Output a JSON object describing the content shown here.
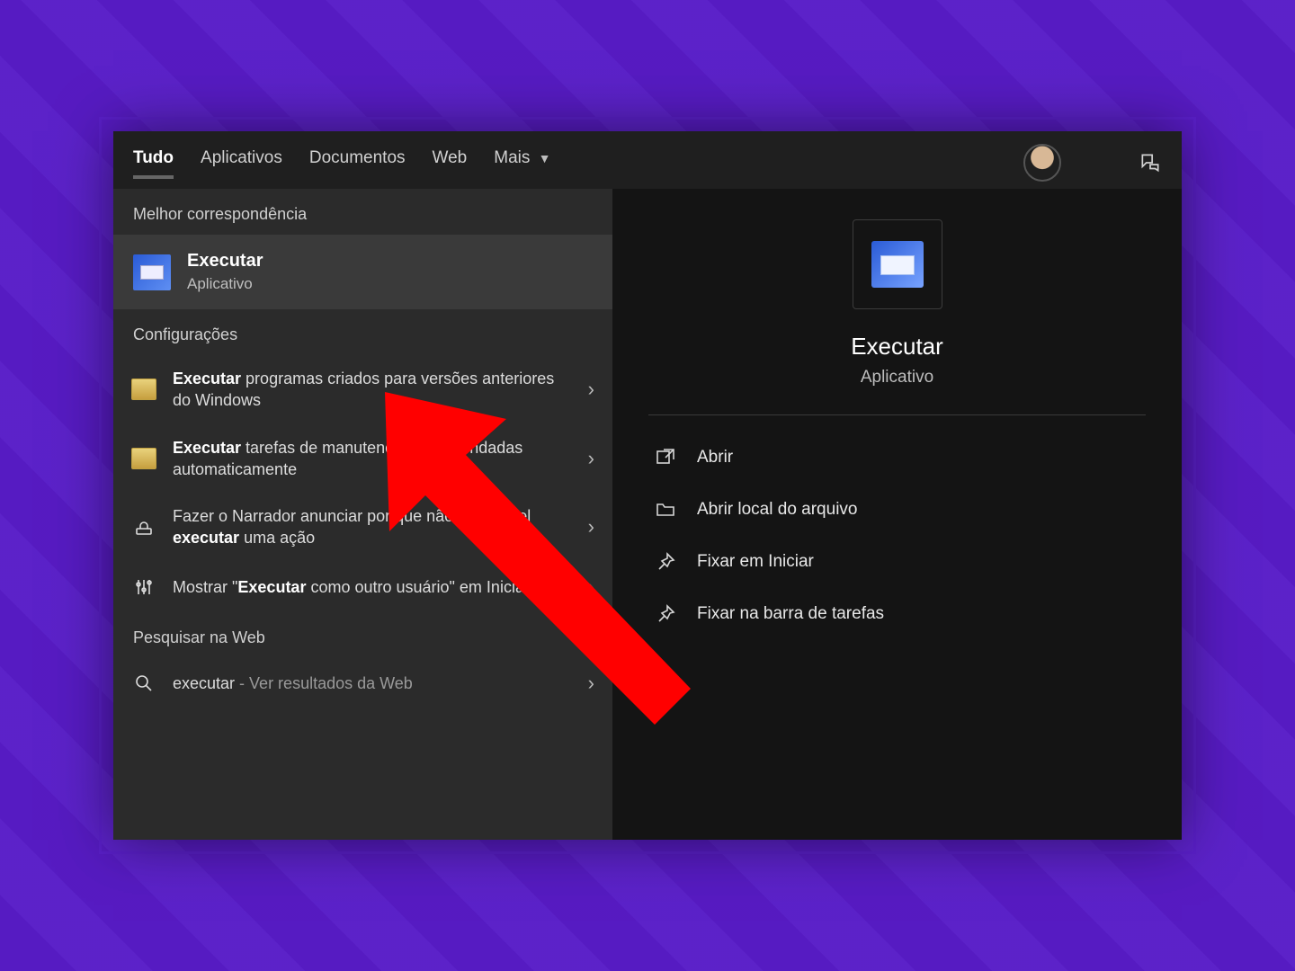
{
  "tabs": {
    "all": "Tudo",
    "apps": "Aplicativos",
    "docs": "Documentos",
    "web": "Web",
    "more": "Mais"
  },
  "left": {
    "best_label": "Melhor correspondência",
    "best_title": "Executar",
    "best_sub": "Aplicativo",
    "settings_label": "Configurações",
    "s1_pre": "Executar",
    "s1_rest": " programas criados para versões anteriores do Windows",
    "s2_pre": "Executar",
    "s2_rest": " tarefas de manutenção recomendadas automaticamente",
    "s3_pre": "Fazer o Narrador anunciar por que não é possível ",
    "s3_bold": "executar",
    "s3_post": " uma ação",
    "s4_pre": "Mostrar \"",
    "s4_bold": "Executar",
    "s4_post": " como outro usuário\" em Iniciar",
    "web_label": "Pesquisar na Web",
    "web_term": "executar",
    "web_rest": " - Ver resultados da Web"
  },
  "right": {
    "title": "Executar",
    "sub": "Aplicativo",
    "open": "Abrir",
    "open_loc": "Abrir local do arquivo",
    "pin_start": "Fixar em Iniciar",
    "pin_task": "Fixar na barra de tarefas"
  }
}
